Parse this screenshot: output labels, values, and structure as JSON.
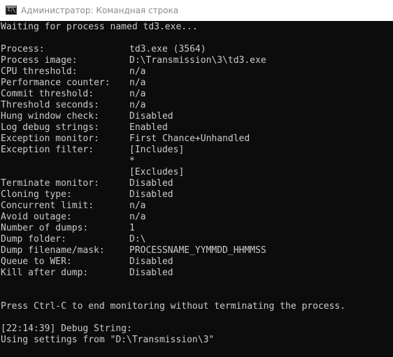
{
  "window": {
    "title": "Администратор: Командная строка",
    "icon": "cmd-prompt-icon",
    "icon_glyph": "C:\\_"
  },
  "console": {
    "waiting": "Waiting for process named td3.exe...",
    "settings": [
      {
        "label": "Process:",
        "value": "td3.exe (3564)"
      },
      {
        "label": "Process image:",
        "value": "D:\\Transmission\\3\\td3.exe"
      },
      {
        "label": "CPU threshold:",
        "value": "n/a"
      },
      {
        "label": "Performance counter:",
        "value": "n/a"
      },
      {
        "label": "Commit threshold:",
        "value": "n/a"
      },
      {
        "label": "Threshold seconds:",
        "value": "n/a"
      },
      {
        "label": "Hung window check:",
        "value": "Disabled"
      },
      {
        "label": "Log debug strings:",
        "value": "Enabled"
      },
      {
        "label": "Exception monitor:",
        "value": "First Chance+Unhandled"
      },
      {
        "label": "Exception filter:",
        "value": "[Includes]"
      },
      {
        "label": "",
        "value": "*"
      },
      {
        "label": "",
        "value": "[Excludes]"
      },
      {
        "label": "Terminate monitor:",
        "value": "Disabled"
      },
      {
        "label": "Cloning type:",
        "value": "Disabled"
      },
      {
        "label": "Concurrent limit:",
        "value": "n/a"
      },
      {
        "label": "Avoid outage:",
        "value": "n/a"
      },
      {
        "label": "Number of dumps:",
        "value": "1"
      },
      {
        "label": "Dump folder:",
        "value": "D:\\"
      },
      {
        "label": "Dump filename/mask:",
        "value": "PROCESSNAME_YYMMDD_HHMMSS"
      },
      {
        "label": "Queue to WER:",
        "value": "Disabled"
      },
      {
        "label": "Kill after dump:",
        "value": "Disabled"
      }
    ],
    "press_ctrl_c": "Press Ctrl-C to end monitoring without terminating the process.",
    "debug_string": "[22:14:39] Debug String:",
    "using_settings": "Using settings from \"D:\\Transmission\\3\""
  },
  "colors": {
    "console_bg": "#0c0c0c",
    "console_text": "#cccccc",
    "titlebar_bg": "#ffffff",
    "title_text": "#8c8c8c"
  }
}
